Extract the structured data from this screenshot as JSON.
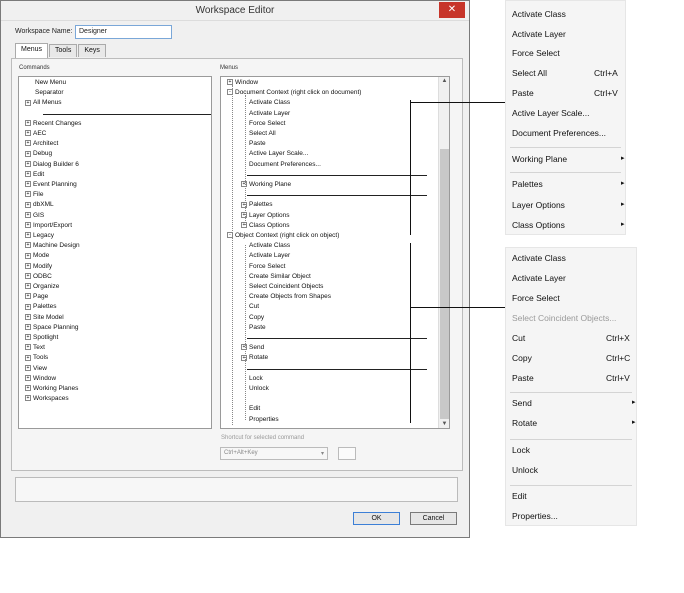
{
  "dialog": {
    "title": "Workspace Editor",
    "close": "✕",
    "workspace_name_label": "Workspace Name:",
    "workspace_name_value": "Designer",
    "tabs": [
      "Menus",
      "Tools",
      "Keys"
    ],
    "commands_label": "Commands",
    "menus_label": "Menus",
    "commands": [
      {
        "label": "New Menu",
        "expander": ""
      },
      {
        "label": "Separator",
        "expander": ""
      },
      {
        "label": "All Menus",
        "expander": "+"
      },
      {
        "label": "",
        "expander": "sep"
      },
      {
        "label": "Recent Changes",
        "expander": "+"
      },
      {
        "label": "AEC",
        "expander": "+"
      },
      {
        "label": "Architect",
        "expander": "+"
      },
      {
        "label": "Debug",
        "expander": "+"
      },
      {
        "label": "Dialog Builder 6",
        "expander": "+"
      },
      {
        "label": "Edit",
        "expander": "+"
      },
      {
        "label": "Event Planning",
        "expander": "+"
      },
      {
        "label": "File",
        "expander": "+"
      },
      {
        "label": "dbXML",
        "expander": "+"
      },
      {
        "label": "GIS",
        "expander": "+"
      },
      {
        "label": "Import/Export",
        "expander": "+"
      },
      {
        "label": "Legacy",
        "expander": "+"
      },
      {
        "label": "Machine Design",
        "expander": "+"
      },
      {
        "label": "Mode",
        "expander": "+"
      },
      {
        "label": "Modify",
        "expander": "+"
      },
      {
        "label": "ODBC",
        "expander": "+"
      },
      {
        "label": "Organize",
        "expander": "+"
      },
      {
        "label": "Page",
        "expander": "+"
      },
      {
        "label": "Palettes",
        "expander": "+"
      },
      {
        "label": "Site Model",
        "expander": "+"
      },
      {
        "label": "Space Planning",
        "expander": "+"
      },
      {
        "label": "Spotlight",
        "expander": "+"
      },
      {
        "label": "Text",
        "expander": "+"
      },
      {
        "label": "Tools",
        "expander": "+"
      },
      {
        "label": "View",
        "expander": "+"
      },
      {
        "label": "Window",
        "expander": "+"
      },
      {
        "label": "Working Planes",
        "expander": "+"
      },
      {
        "label": "Workspaces",
        "expander": "+"
      }
    ],
    "menus_tree": [
      {
        "label": "Window",
        "indent": 0,
        "expander": "+"
      },
      {
        "label": "Document Context (right click on document)",
        "indent": 0,
        "expander": "-"
      },
      {
        "label": "Activate Class",
        "indent": 1,
        "expander": ""
      },
      {
        "label": "Activate Layer",
        "indent": 1,
        "expander": ""
      },
      {
        "label": "Force Select",
        "indent": 1,
        "expander": ""
      },
      {
        "label": "Select All",
        "indent": 1,
        "expander": ""
      },
      {
        "label": "Paste",
        "indent": 1,
        "expander": ""
      },
      {
        "label": "Active Layer Scale...",
        "indent": 1,
        "expander": ""
      },
      {
        "label": "Document Preferences...",
        "indent": 1,
        "expander": ""
      },
      {
        "label": "",
        "indent": 1,
        "expander": "sep"
      },
      {
        "label": "Working Plane",
        "indent": 1,
        "expander": "+"
      },
      {
        "label": "",
        "indent": 1,
        "expander": "sep"
      },
      {
        "label": "Palettes",
        "indent": 1,
        "expander": "+"
      },
      {
        "label": "Layer Options",
        "indent": 1,
        "expander": "+"
      },
      {
        "label": "Class Options",
        "indent": 1,
        "expander": "+"
      },
      {
        "label": "Object Context (right click on object)",
        "indent": 0,
        "expander": "-"
      },
      {
        "label": "Activate Class",
        "indent": 1,
        "expander": ""
      },
      {
        "label": "Activate Layer",
        "indent": 1,
        "expander": ""
      },
      {
        "label": "Force Select",
        "indent": 1,
        "expander": ""
      },
      {
        "label": "Create Similar Object",
        "indent": 1,
        "expander": ""
      },
      {
        "label": "Select Coincident Objects",
        "indent": 1,
        "expander": ""
      },
      {
        "label": "Create Objects from Shapes",
        "indent": 1,
        "expander": ""
      },
      {
        "label": "Cut",
        "indent": 1,
        "expander": ""
      },
      {
        "label": "Copy",
        "indent": 1,
        "expander": ""
      },
      {
        "label": "Paste",
        "indent": 1,
        "expander": ""
      },
      {
        "label": "",
        "indent": 1,
        "expander": "sep"
      },
      {
        "label": "Send",
        "indent": 1,
        "expander": "+"
      },
      {
        "label": "Rotate",
        "indent": 1,
        "expander": "+"
      },
      {
        "label": "",
        "indent": 1,
        "expander": "sep"
      },
      {
        "label": "Lock",
        "indent": 1,
        "expander": ""
      },
      {
        "label": "Unlock",
        "indent": 1,
        "expander": ""
      },
      {
        "label": "",
        "indent": 1,
        "expander": "blank"
      },
      {
        "label": "Edit",
        "indent": 1,
        "expander": ""
      },
      {
        "label": "Properties",
        "indent": 1,
        "expander": ""
      }
    ],
    "shortcut_label": "Shortcut for selected command",
    "shortcut_value": "Ctrl+Alt+Key",
    "ok_label": "OK",
    "cancel_label": "Cancel"
  },
  "context_menu_document": {
    "items": [
      {
        "label": "Activate Class",
        "shortcut": "",
        "submenu": false
      },
      {
        "label": "Activate Layer",
        "shortcut": "",
        "submenu": false
      },
      {
        "label": "Force Select",
        "shortcut": "",
        "submenu": false
      },
      {
        "label": "Select All",
        "shortcut": "Ctrl+A",
        "submenu": false
      },
      {
        "label": "Paste",
        "shortcut": "Ctrl+V",
        "submenu": false
      },
      {
        "label": "Active Layer Scale...",
        "shortcut": "",
        "submenu": false
      },
      {
        "label": "Document Preferences...",
        "shortcut": "",
        "submenu": false
      },
      {
        "label": "Working Plane",
        "shortcut": "",
        "submenu": true
      },
      {
        "label": "Palettes",
        "shortcut": "",
        "submenu": true
      },
      {
        "label": "Layer Options",
        "shortcut": "",
        "submenu": true
      },
      {
        "label": "Class Options",
        "shortcut": "",
        "submenu": true
      }
    ]
  },
  "context_menu_object": {
    "items": [
      {
        "label": "Activate Class",
        "shortcut": "",
        "submenu": false,
        "disabled": false
      },
      {
        "label": "Activate Layer",
        "shortcut": "",
        "submenu": false,
        "disabled": false
      },
      {
        "label": "Force Select",
        "shortcut": "",
        "submenu": false,
        "disabled": false
      },
      {
        "label": "Select Coincident Objects...",
        "shortcut": "",
        "submenu": false,
        "disabled": true
      },
      {
        "label": "Cut",
        "shortcut": "Ctrl+X",
        "submenu": false,
        "disabled": false
      },
      {
        "label": "Copy",
        "shortcut": "Ctrl+C",
        "submenu": false,
        "disabled": false
      },
      {
        "label": "Paste",
        "shortcut": "Ctrl+V",
        "submenu": false,
        "disabled": false
      },
      {
        "label": "Send",
        "shortcut": "",
        "submenu": true,
        "disabled": false
      },
      {
        "label": "Rotate",
        "shortcut": "",
        "submenu": true,
        "disabled": false
      },
      {
        "label": "Lock",
        "shortcut": "",
        "submenu": false,
        "disabled": false
      },
      {
        "label": "Unlock",
        "shortcut": "",
        "submenu": false,
        "disabled": false
      },
      {
        "label": "Edit",
        "shortcut": "",
        "submenu": false,
        "disabled": false
      },
      {
        "label": "Properties...",
        "shortcut": "",
        "submenu": false,
        "disabled": false
      }
    ]
  },
  "icons": {
    "close": "close-icon",
    "expand": "plus-box-icon",
    "collapse": "minus-box-icon",
    "submenu": "chevron-right-icon",
    "scroll_up": "arrow-up-icon",
    "scroll_down": "arrow-down-icon",
    "dropdown": "chevron-down-icon"
  },
  "colors": {
    "close_button": "#c7352a",
    "focus_border": "#3c7fd6",
    "disabled_text": "#9a9a9a"
  }
}
